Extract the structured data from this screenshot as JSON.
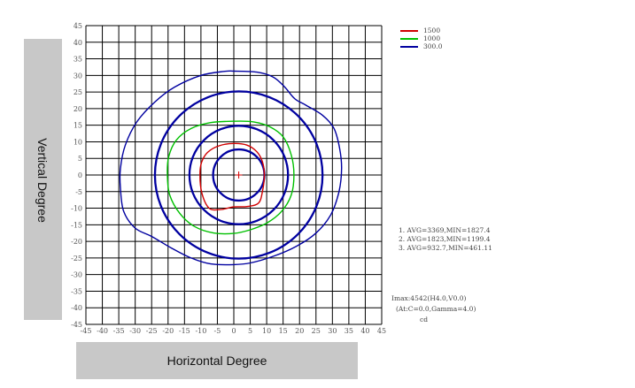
{
  "chart_data": {
    "type": "contour",
    "xlabel": "Horizontal Degree",
    "ylabel": "Vertical Degree",
    "xlim": [
      -45,
      45
    ],
    "ylim": [
      -45,
      45
    ],
    "xticks": [
      "-45",
      "-40",
      "-35",
      "-30",
      "-25",
      "-20",
      "-15",
      "-10",
      "-5",
      "0",
      "5",
      "10",
      "15",
      "20",
      "25",
      "30",
      "35",
      "40",
      "45"
    ],
    "yticks": [
      "45",
      "40",
      "35",
      "30",
      "25",
      "20",
      "15",
      "10",
      "5",
      "0",
      "-5",
      "-10",
      "-15",
      "-20",
      "-25",
      "-30",
      "-35",
      "-40",
      "-45"
    ],
    "grid": true,
    "legend_position": "top-right",
    "legend": [
      {
        "label": "1500",
        "color": "#d00000"
      },
      {
        "label": "1000",
        "color": "#00c000"
      },
      {
        "label": "300.0",
        "color": "#0000a0"
      }
    ],
    "contours": [
      {
        "level": "1500",
        "color": "#d00000",
        "points": [
          [
            0,
            9.5
          ],
          [
            4,
            9
          ],
          [
            7,
            7
          ],
          [
            8.7,
            4
          ],
          [
            9.3,
            0
          ],
          [
            8.7,
            -5
          ],
          [
            7.5,
            -8.5
          ],
          [
            4,
            -9.5
          ],
          [
            0,
            -9.6
          ],
          [
            -4,
            -10.4
          ],
          [
            -7.5,
            -10
          ],
          [
            -9.7,
            -5.5
          ],
          [
            -10.3,
            0
          ],
          [
            -9.8,
            3.8
          ],
          [
            -8,
            6.8
          ],
          [
            -4.5,
            8.8
          ],
          [
            0,
            9.5
          ]
        ]
      },
      {
        "level": "1000",
        "color": "#00c000",
        "points": [
          [
            0,
            16.2
          ],
          [
            6,
            16
          ],
          [
            11,
            14.5
          ],
          [
            15,
            11.5
          ],
          [
            17.5,
            6
          ],
          [
            18.3,
            0
          ],
          [
            17.5,
            -6
          ],
          [
            14.5,
            -11
          ],
          [
            10,
            -14.5
          ],
          [
            5,
            -16.5
          ],
          [
            0,
            -17.6
          ],
          [
            -6,
            -17.5
          ],
          [
            -12,
            -15.5
          ],
          [
            -16.5,
            -11.5
          ],
          [
            -19.5,
            -6
          ],
          [
            -20.2,
            0
          ],
          [
            -19.8,
            5.5
          ],
          [
            -17.5,
            10.5
          ],
          [
            -13,
            14
          ],
          [
            -7,
            15.8
          ],
          [
            0,
            16.2
          ]
        ]
      },
      {
        "level": "300.0",
        "color": "#0000a0",
        "points": [
          [
            0,
            31.3
          ],
          [
            7,
            31
          ],
          [
            12,
            29.5
          ],
          [
            15.5,
            26.5
          ],
          [
            18.5,
            23
          ],
          [
            22,
            21
          ],
          [
            27,
            18
          ],
          [
            30.5,
            14
          ],
          [
            32.2,
            8
          ],
          [
            32.8,
            2
          ],
          [
            32,
            -5
          ],
          [
            29.5,
            -12
          ],
          [
            25,
            -17.5
          ],
          [
            19,
            -21.5
          ],
          [
            12,
            -24.5
          ],
          [
            5,
            -26.5
          ],
          [
            0,
            -27
          ],
          [
            -7,
            -26.8
          ],
          [
            -13,
            -25
          ],
          [
            -19,
            -22
          ],
          [
            -25,
            -18.5
          ],
          [
            -30,
            -16
          ],
          [
            -33.5,
            -11
          ],
          [
            -34.5,
            -4
          ],
          [
            -34.5,
            2
          ],
          [
            -33,
            9
          ],
          [
            -29.5,
            16
          ],
          [
            -24,
            22
          ],
          [
            -18,
            26.5
          ],
          [
            -10,
            30
          ],
          [
            -3,
            31.2
          ],
          [
            0,
            31.3
          ]
        ]
      }
    ],
    "rings": [
      {
        "radius": 7.8,
        "color": "#0000a0"
      },
      {
        "radius": 15,
        "color": "#0000a0"
      },
      {
        "radius": 25.5,
        "color": "#0000a0"
      }
    ],
    "center_marker": [
      1.5,
      0
    ]
  },
  "stats": [
    "1.  AVG=3369,MIN=1827.4",
    "2.  AVG=1823,MIN=1199.4",
    "3.  AVG=932.7,MIN=461.11"
  ],
  "imax": {
    "line1": "Imax:4542(H4.0,V0.0)",
    "line2": "(At:C=0.0,Gamma=4.0)",
    "unit": "cd"
  }
}
